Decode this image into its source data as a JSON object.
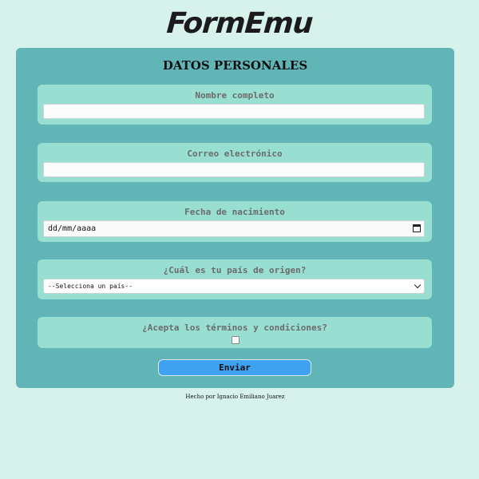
{
  "header": {
    "logo_text": "FormEmu"
  },
  "form": {
    "title": "DATOS PERSONALES",
    "fields": {
      "full_name": {
        "label": "Nombre completo",
        "value": ""
      },
      "email": {
        "label": "Correo electrónico",
        "value": ""
      },
      "birth_date": {
        "label": "Fecha de nacimiento",
        "placeholder": "dd/mm/aaaa"
      },
      "country": {
        "label": "¿Cuál es tu país de origen?",
        "selected": "--Selecciona un país--"
      },
      "terms": {
        "label": "¿Acepta los términos y condiciones?",
        "checked": false
      }
    },
    "submit_label": "Enviar"
  },
  "footer": {
    "text": "Hecho por Ignacio Emiliano Juarez"
  },
  "colors": {
    "background": "#d6f2eb",
    "card": "#62b5b7",
    "field_group": "#98dfd2",
    "button": "#3fa2f1"
  }
}
